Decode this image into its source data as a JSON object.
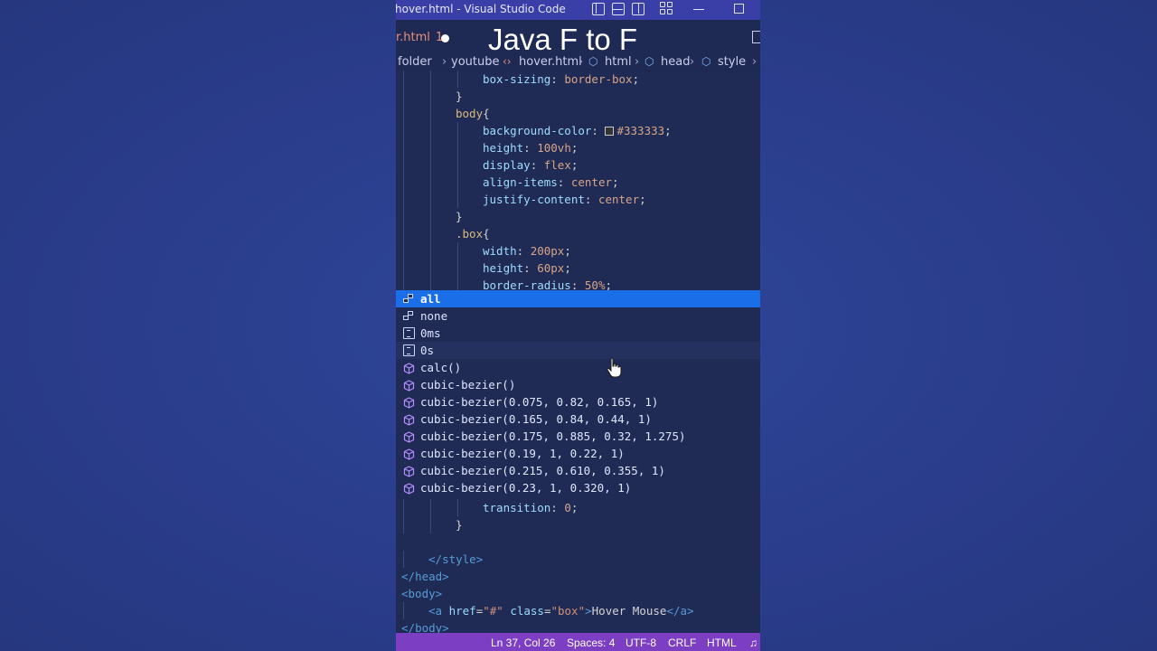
{
  "window": {
    "title": "hover.html - Visual Studio Code"
  },
  "overlay": {
    "caption": "Java F to F"
  },
  "tab": {
    "name": "r.html",
    "problems": "1"
  },
  "breadcrumb": {
    "items": [
      "folder",
      "youtube",
      "hover.html",
      "html",
      "head",
      "style"
    ]
  },
  "code_top": [
    {
      "indent": 3,
      "parts": [
        {
          "t": "box-sizing",
          "c": "prop"
        },
        {
          "t": ": ",
          "c": "punc"
        },
        {
          "t": "border-box",
          "c": "val"
        },
        {
          "t": ";",
          "c": "punc"
        }
      ]
    },
    {
      "indent": 2,
      "parts": [
        {
          "t": "}",
          "c": "punc"
        }
      ]
    },
    {
      "indent": 2,
      "parts": [
        {
          "t": "body",
          "c": "sel"
        },
        {
          "t": "{",
          "c": "punc"
        }
      ]
    },
    {
      "indent": 3,
      "parts": [
        {
          "t": "background-color",
          "c": "prop"
        },
        {
          "t": ": ",
          "c": "punc"
        },
        {
          "t": "#333333",
          "c": "val",
          "swatch": true
        },
        {
          "t": ";",
          "c": "punc"
        }
      ]
    },
    {
      "indent": 3,
      "parts": [
        {
          "t": "height",
          "c": "prop"
        },
        {
          "t": ": ",
          "c": "punc"
        },
        {
          "t": "100vh",
          "c": "val"
        },
        {
          "t": ";",
          "c": "punc"
        }
      ]
    },
    {
      "indent": 3,
      "parts": [
        {
          "t": "display",
          "c": "prop"
        },
        {
          "t": ": ",
          "c": "punc"
        },
        {
          "t": "flex",
          "c": "val"
        },
        {
          "t": ";",
          "c": "punc"
        }
      ]
    },
    {
      "indent": 3,
      "parts": [
        {
          "t": "align-items",
          "c": "prop"
        },
        {
          "t": ": ",
          "c": "punc"
        },
        {
          "t": "center",
          "c": "val"
        },
        {
          "t": ";",
          "c": "punc"
        }
      ]
    },
    {
      "indent": 3,
      "parts": [
        {
          "t": "justify-content",
          "c": "prop"
        },
        {
          "t": ": ",
          "c": "punc"
        },
        {
          "t": "center",
          "c": "val"
        },
        {
          "t": ";",
          "c": "punc"
        }
      ]
    },
    {
      "indent": 2,
      "parts": [
        {
          "t": "}",
          "c": "punc"
        }
      ]
    },
    {
      "indent": 2,
      "parts": [
        {
          "t": ".box",
          "c": "sel"
        },
        {
          "t": "{",
          "c": "punc"
        }
      ]
    },
    {
      "indent": 3,
      "parts": [
        {
          "t": "width",
          "c": "prop"
        },
        {
          "t": ": ",
          "c": "punc"
        },
        {
          "t": "200px",
          "c": "val"
        },
        {
          "t": ";",
          "c": "punc"
        }
      ]
    },
    {
      "indent": 3,
      "parts": [
        {
          "t": "height",
          "c": "prop"
        },
        {
          "t": ": ",
          "c": "punc"
        },
        {
          "t": "60px",
          "c": "val"
        },
        {
          "t": ";",
          "c": "punc"
        }
      ]
    },
    {
      "indent": 3,
      "parts": [
        {
          "t": "border-radius",
          "c": "prop"
        },
        {
          "t": ": ",
          "c": "punc"
        },
        {
          "t": "50%",
          "c": "val"
        },
        {
          "t": ";",
          "c": "punc"
        }
      ]
    }
  ],
  "suggestions": [
    {
      "label": "all",
      "icon": "enum-icon",
      "state": "active"
    },
    {
      "label": "none",
      "icon": "enum-icon",
      "state": ""
    },
    {
      "label": "0ms",
      "icon": "unit-icon",
      "state": ""
    },
    {
      "label": "0s",
      "icon": "unit-icon",
      "state": "hover"
    },
    {
      "label": "calc()",
      "icon": "function-icon",
      "state": ""
    },
    {
      "label": "cubic-bezier()",
      "icon": "function-icon",
      "state": ""
    },
    {
      "label": "cubic-bezier(0.075, 0.82, 0.165, 1)",
      "icon": "function-icon",
      "state": ""
    },
    {
      "label": "cubic-bezier(0.165, 0.84, 0.44, 1)",
      "icon": "function-icon",
      "state": ""
    },
    {
      "label": "cubic-bezier(0.175, 0.885, 0.32, 1.275)",
      "icon": "function-icon",
      "state": ""
    },
    {
      "label": "cubic-bezier(0.19, 1, 0.22, 1)",
      "icon": "function-icon",
      "state": ""
    },
    {
      "label": "cubic-bezier(0.215, 0.610, 0.355, 1)",
      "icon": "function-icon",
      "state": ""
    },
    {
      "label": "cubic-bezier(0.23, 1, 0.320, 1)",
      "icon": "function-icon",
      "state": ""
    }
  ],
  "code_bottom": [
    {
      "indent": 3,
      "parts": [
        {
          "t": "transition",
          "c": "prop"
        },
        {
          "t": ": ",
          "c": "punc"
        },
        {
          "t": "0",
          "c": "val"
        },
        {
          "t": ";",
          "c": "punc"
        }
      ]
    },
    {
      "indent": 2,
      "parts": [
        {
          "t": "}",
          "c": "punc"
        }
      ]
    },
    {
      "indent": 0,
      "parts": []
    },
    {
      "indent": 1,
      "parts": [
        {
          "t": "</",
          "c": "tag"
        },
        {
          "t": "style",
          "c": "tag"
        },
        {
          "t": ">",
          "c": "tag"
        }
      ]
    },
    {
      "indent": 0,
      "parts": [
        {
          "t": "</",
          "c": "tag"
        },
        {
          "t": "head",
          "c": "tag"
        },
        {
          "t": ">",
          "c": "tag"
        }
      ]
    },
    {
      "indent": 0,
      "parts": [
        {
          "t": "<",
          "c": "tag"
        },
        {
          "t": "body",
          "c": "tag"
        },
        {
          "t": ">",
          "c": "tag"
        }
      ]
    },
    {
      "indent": 1,
      "parts": [
        {
          "t": "<a ",
          "c": "tag"
        },
        {
          "t": "href",
          "c": "attr"
        },
        {
          "t": "=",
          "c": "punc"
        },
        {
          "t": "\"#\"",
          "c": "str"
        },
        {
          "t": " class",
          "c": "attr"
        },
        {
          "t": "=",
          "c": "punc"
        },
        {
          "t": "\"box\"",
          "c": "str"
        },
        {
          "t": ">",
          "c": "tag"
        },
        {
          "t": "Hover Mouse",
          "c": "text"
        },
        {
          "t": "</a>",
          "c": "tag"
        }
      ]
    },
    {
      "indent": 0,
      "parts": [
        {
          "t": "</",
          "c": "tag"
        },
        {
          "t": "body",
          "c": "tag"
        },
        {
          "t": ">",
          "c": "tag"
        }
      ]
    }
  ],
  "status": {
    "position": "Ln 37, Col 26",
    "spaces": "Spaces: 4",
    "encoding": "UTF-8",
    "eol": "CRLF",
    "language": "HTML"
  }
}
